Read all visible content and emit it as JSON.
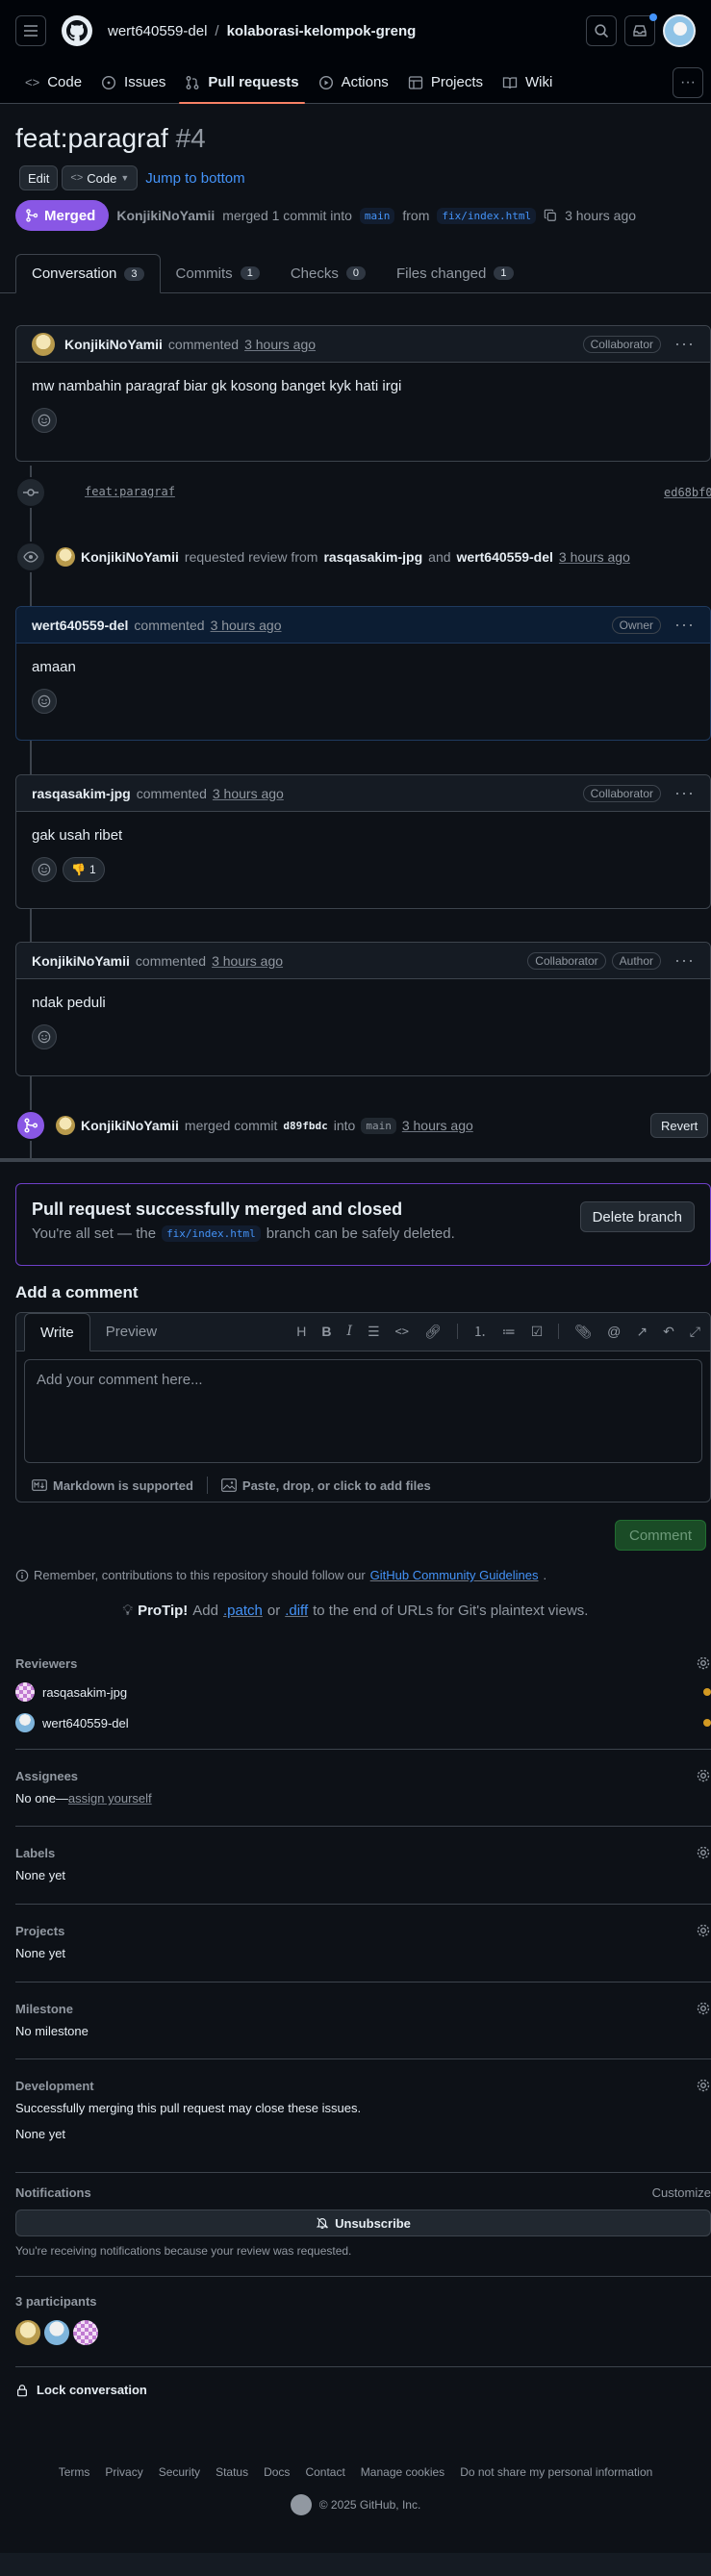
{
  "header": {
    "owner": "wert640559-del",
    "separator": "/",
    "repo": "kolaborasi-kelompok-greng"
  },
  "repo_nav": {
    "items": [
      {
        "label": "Code",
        "icon": "code-icon"
      },
      {
        "label": "Issues",
        "icon": "issue-opened-icon"
      },
      {
        "label": "Pull requests",
        "icon": "git-pull-request-icon",
        "selected": true
      },
      {
        "label": "Actions",
        "icon": "play-icon"
      },
      {
        "label": "Projects",
        "icon": "table-icon"
      },
      {
        "label": "Wiki",
        "icon": "book-icon"
      }
    ]
  },
  "pr": {
    "title": "feat:paragraf",
    "number": "#4",
    "edit_label": "Edit",
    "code_label": "Code",
    "jump_label": "Jump to bottom",
    "state": "Merged",
    "author": "KonjikiNoYamii",
    "merged_text": "merged 1 commit into",
    "base_branch": "main",
    "from_text": "from",
    "head_branch": "fix/index.html",
    "time": "3 hours ago"
  },
  "tabs": [
    {
      "label": "Conversation",
      "count": "3",
      "selected": true
    },
    {
      "label": "Commits",
      "count": "1"
    },
    {
      "label": "Checks",
      "count": "0"
    },
    {
      "label": "Files changed",
      "count": "1"
    }
  ],
  "comments": [
    {
      "author": "KonjikiNoYamii",
      "verb": "commented",
      "time": "3 hours ago",
      "badges": [
        "Collaborator"
      ],
      "body": "mw nambahin paragraf biar gk kosong banget kyk hati irgi"
    },
    {
      "author": "wert640559-del",
      "verb": "commented",
      "time": "3 hours ago",
      "badges": [
        "Owner"
      ],
      "body": "amaan"
    },
    {
      "author": "rasqasakim-jpg",
      "verb": "commented",
      "time": "3 hours ago",
      "badges": [
        "Collaborator"
      ],
      "body": "gak usah ribet",
      "reaction": {
        "emoji": "👎",
        "count": "1"
      }
    },
    {
      "author": "KonjikiNoYamii",
      "verb": "commented",
      "time": "3 hours ago",
      "badges": [
        "Collaborator",
        "Author"
      ],
      "body": "ndak peduli"
    }
  ],
  "timeline": {
    "commit_msg": "feat:paragraf",
    "commit_sha": "ed68bf0",
    "review_actor": "KonjikiNoYamii",
    "review_text": "requested review from",
    "review_user1": "rasqasakim-jpg",
    "review_and": "and",
    "review_user2": "wert640559-del",
    "review_time": "3 hours ago",
    "merge_actor": "KonjikiNoYamii",
    "merge_text": "merged commit",
    "merge_sha": "d89fbdc",
    "merge_into": "into",
    "merge_branch": "main",
    "merge_time": "3 hours ago",
    "revert_label": "Revert"
  },
  "merge_box": {
    "title": "Pull request successfully merged and closed",
    "text_before": "You're all set — the",
    "branch": "fix/index.html",
    "text_after": "branch can be safely deleted.",
    "button": "Delete branch"
  },
  "add_comment": {
    "heading": "Add a comment",
    "write_tab": "Write",
    "preview_tab": "Preview",
    "placeholder": "Add your comment here...",
    "markdown_note": "Markdown is supported",
    "paste_note": "Paste, drop, or click to add files",
    "submit": "Comment",
    "guidelines_before": "Remember, contributions to this repository should follow our",
    "guidelines_link": "GitHub Community Guidelines",
    "guidelines_after": ".",
    "protip_label": "ProTip!",
    "protip_add": "Add",
    "protip_patch": ".patch",
    "protip_or": "or",
    "protip_diff": ".diff",
    "protip_rest": "to the end of URLs for Git's plaintext views."
  },
  "sidebar": {
    "reviewers_title": "Reviewers",
    "reviewers": [
      "rasqasakim-jpg",
      "wert640559-del"
    ],
    "assignees_title": "Assignees",
    "assignees_none": "No one—",
    "assign_yourself": "assign yourself",
    "labels_title": "Labels",
    "labels_value": "None yet",
    "projects_title": "Projects",
    "projects_value": "None yet",
    "milestone_title": "Milestone",
    "milestone_value": "No milestone",
    "development_title": "Development",
    "development_desc": "Successfully merging this pull request may close these issues.",
    "development_value": "None yet",
    "notifications_title": "Notifications",
    "customize": "Customize",
    "unsubscribe": "Unsubscribe",
    "notif_reason": "You're receiving notifications because your review was requested.",
    "participants_title": "3 participants",
    "lock": "Lock conversation"
  },
  "footer": {
    "links": [
      "Terms",
      "Privacy",
      "Security",
      "Status",
      "Docs",
      "Contact",
      "Manage cookies",
      "Do not share my personal information"
    ],
    "copyright": "© 2025 GitHub, Inc."
  },
  "colors": {
    "bg": "#0d1117",
    "merged": "#8957e5",
    "accent_link": "#4493f8",
    "nav_underline": "#f78166",
    "comment_button": "#238636",
    "pending_dot": "#d29922"
  }
}
